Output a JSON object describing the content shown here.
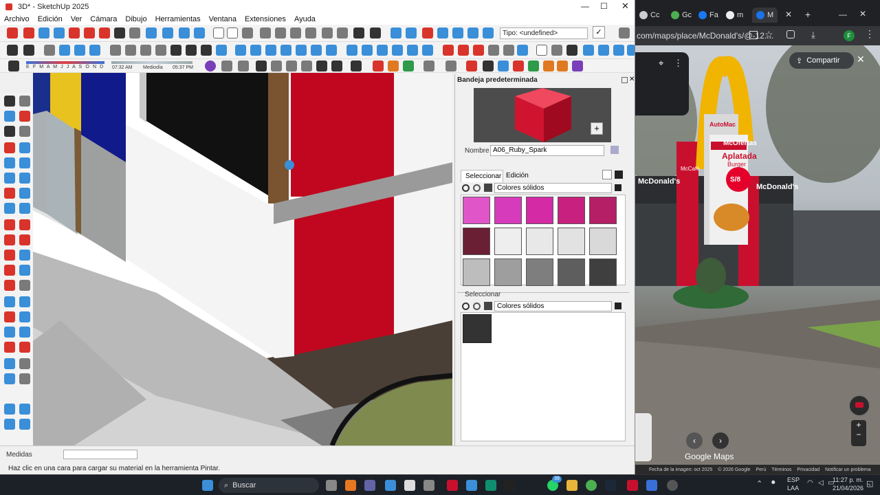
{
  "sketchup": {
    "title": "3D* - SketchUp 2025",
    "menu": [
      "Archivo",
      "Edición",
      "Ver",
      "Cámara",
      "Dibujo",
      "Herramientas",
      "Ventana",
      "Extensiones",
      "Ayuda"
    ],
    "type_field": "Tipo: <undefined>",
    "shadow_months": "E F M A M J J A S O N D",
    "time_start": "07:32 AM",
    "time_mid": "Mediodía",
    "time_end": "05:37 PM",
    "tray": {
      "title": "Bandeja predeterminada",
      "name_label": "Nombre",
      "name_value": "A06_Ruby_Spark",
      "tab_select": "Seleccionar",
      "tab_edit": "Edición",
      "collection": "Colores sólidos",
      "second_section": "Seleccionar",
      "second_collection": "Colores sólidos",
      "swatches": [
        [
          "#e055c8",
          "#d63bbb",
          "#d42aa5",
          "#c8207f",
          "#b41f66"
        ],
        [
          "#6b1f35",
          "#eeeeee",
          "#e8e8e8",
          "#e2e2e2",
          "#d9d9d9"
        ],
        [
          "#bdbdbd",
          "#9e9e9e",
          "#7e7e7e",
          "#5e5e5e",
          "#3f3f3f"
        ]
      ]
    },
    "measure_label": "Medidas",
    "hint": "Haz clic en una cara para cargar su material en la herramienta Pintar."
  },
  "browser": {
    "tabs": [
      "Cc",
      "Gc",
      "Fa",
      "m",
      "M"
    ],
    "url": "com/maps/place/McDonald's/@-12....",
    "share_label": "Compartir",
    "image_date": "Fecha de la imagen: oct 2025",
    "copyright": "© 2026 Google",
    "footer_links": [
      "Perú",
      "Términos",
      "Privacidad",
      "Notificar un problema"
    ],
    "brand": "Google Maps",
    "sign_mcd": "McDonald's",
    "sign_mcofertas": "McOfertas",
    "sign_aplatada": "Aplatada",
    "sign_burger": "Burger",
    "sign_automac": "AutoMac",
    "sign_mccafe": "McCafé",
    "sign_price": "S/8"
  },
  "taskbar": {
    "search": "Buscar",
    "lang": "ESP",
    "lang2": "LAA",
    "time": "11:27 p. m.",
    "date": "21/04/2026",
    "badge": "39"
  }
}
